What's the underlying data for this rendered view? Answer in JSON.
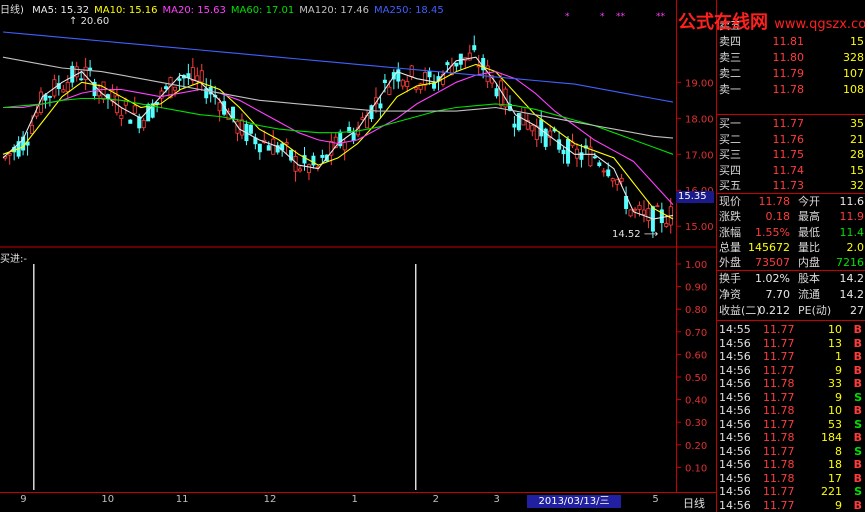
{
  "chart_data": {
    "type": "candlestick",
    "period_label": "日线",
    "moving_averages": [
      {
        "name": "MA5",
        "value": "15.32",
        "color": "#e8e8e8"
      },
      {
        "name": "MA10",
        "value": "15.16",
        "color": "#ffff00"
      },
      {
        "name": "MA20",
        "value": "15.63",
        "color": "#ff40ff"
      },
      {
        "name": "MA60",
        "value": "17.01",
        "color": "#00e000"
      },
      {
        "name": "MA120",
        "value": "17.46",
        "color": "#c0c0c0"
      },
      {
        "name": "MA250",
        "value": "18.45",
        "color": "#4060ff"
      }
    ],
    "title_prefix": "日线)",
    "y_ticks": [
      "19.00",
      "18.00",
      "17.00",
      "16.00",
      "15.00"
    ],
    "ylim": [
      14.45,
      20.9
    ],
    "high_label": "20.60",
    "low_label": "14.52",
    "current_tag": "15.35",
    "x_ticks": [
      "9",
      "10",
      "11",
      "12",
      "1",
      "2",
      "3",
      "5"
    ],
    "highlight_date": "2013/03/13/三",
    "ma_series": {
      "ma5": [
        16.9,
        17.4,
        18.6,
        19.0,
        19.3,
        18.7,
        18.3,
        18.0,
        18.6,
        19.2,
        19.0,
        18.5,
        17.7,
        17.4,
        17.2,
        16.7,
        16.6,
        17.3,
        17.7,
        18.5,
        19.3,
        19.1,
        19.0,
        19.6,
        19.7,
        19.0,
        18.1,
        17.8,
        17.4,
        17.0,
        17.0,
        16.6,
        15.4,
        15.2,
        15.3
      ],
      "ma10": [
        17.0,
        17.2,
        17.9,
        18.6,
        19.0,
        18.9,
        18.6,
        18.3,
        18.4,
        18.8,
        19.0,
        18.8,
        18.3,
        17.7,
        17.4,
        17.0,
        16.7,
        16.9,
        17.3,
        17.9,
        18.6,
        18.9,
        19.0,
        19.3,
        19.5,
        19.3,
        18.7,
        18.1,
        17.7,
        17.3,
        17.1,
        16.9,
        16.2,
        15.5,
        15.2
      ],
      "ma20": [
        18.3,
        18.3,
        18.4,
        18.5,
        18.7,
        18.8,
        18.8,
        18.7,
        18.6,
        18.7,
        18.8,
        18.7,
        18.5,
        18.2,
        17.9,
        17.6,
        17.4,
        17.3,
        17.4,
        17.7,
        18.0,
        18.4,
        18.7,
        19.0,
        19.2,
        19.3,
        19.1,
        18.7,
        18.2,
        17.8,
        17.4,
        17.1,
        16.8,
        16.2,
        15.6
      ],
      "ma60": [
        18.3,
        18.35,
        18.4,
        18.5,
        18.55,
        18.55,
        18.5,
        18.4,
        18.3,
        18.2,
        18.1,
        18.05,
        17.95,
        17.8,
        17.7,
        17.65,
        17.6,
        17.6,
        17.65,
        17.75,
        17.9,
        18.05,
        18.2,
        18.3,
        18.35,
        18.4,
        18.35,
        18.25,
        18.1,
        17.95,
        17.8,
        17.6,
        17.4,
        17.2,
        17.0
      ],
      "ma120": [
        19.7,
        19.6,
        19.5,
        19.4,
        19.35,
        19.3,
        19.2,
        19.1,
        19.0,
        18.9,
        18.8,
        18.7,
        18.6,
        18.5,
        18.45,
        18.4,
        18.35,
        18.3,
        18.25,
        18.2,
        18.2,
        18.2,
        18.2,
        18.2,
        18.25,
        18.3,
        18.2,
        18.1,
        18.0,
        17.9,
        17.8,
        17.7,
        17.6,
        17.5,
        17.45
      ],
      "ma250": [
        20.4,
        20.35,
        20.3,
        20.25,
        20.2,
        20.15,
        20.1,
        20.05,
        20.0,
        19.95,
        19.9,
        19.85,
        19.8,
        19.75,
        19.7,
        19.65,
        19.6,
        19.55,
        19.5,
        19.45,
        19.4,
        19.35,
        19.3,
        19.25,
        19.2,
        19.15,
        19.1,
        19.05,
        19.0,
        18.95,
        18.85,
        18.75,
        18.65,
        18.55,
        18.45
      ]
    },
    "indicator_label": "买进:-",
    "indicator_ticks": [
      "1.00",
      "0.90",
      "0.80",
      "0.70",
      "0.60",
      "0.50",
      "0.40",
      "0.30",
      "0.20",
      "0.10"
    ],
    "signals": [
      {
        "pos": 0.05,
        "value": 1.0
      },
      {
        "pos": 0.615,
        "value": 1.0
      }
    ],
    "markers": [
      "*",
      "*",
      "**",
      "**"
    ]
  },
  "quotes": {
    "asks": [
      {
        "label": "卖五",
        "price": "",
        "vol": ""
      },
      {
        "label": "卖四",
        "price": "11.81",
        "vol": "15"
      },
      {
        "label": "卖三",
        "price": "11.80",
        "vol": "328"
      },
      {
        "label": "卖二",
        "price": "11.79",
        "vol": "107"
      },
      {
        "label": "卖一",
        "price": "11.78",
        "vol": "108"
      }
    ],
    "bids": [
      {
        "label": "买一",
        "price": "11.77",
        "vol": "35"
      },
      {
        "label": "买二",
        "price": "11.76",
        "vol": "21"
      },
      {
        "label": "买三",
        "price": "11.75",
        "vol": "28"
      },
      {
        "label": "买四",
        "price": "11.74",
        "vol": "15"
      },
      {
        "label": "买五",
        "price": "11.73",
        "vol": "32"
      }
    ],
    "stats": [
      {
        "l1": "现价",
        "v1": "11.78",
        "c1": "red",
        "l2": "今开",
        "v2": "11.6",
        "c2": "white"
      },
      {
        "l1": "涨跌",
        "v1": "0.18",
        "c1": "red",
        "l2": "最高",
        "v2": "11.9",
        "c2": "red"
      },
      {
        "l1": "涨幅",
        "v1": "1.55%",
        "c1": "red",
        "l2": "最低",
        "v2": "11.4",
        "c2": "green"
      },
      {
        "l1": "总量",
        "v1": "145672",
        "c1": "yellow",
        "l2": "量比",
        "v2": "2.0",
        "c2": "yellow"
      },
      {
        "l1": "外盘",
        "v1": "73507",
        "c1": "red",
        "l2": "内盘",
        "v2": "7216",
        "c2": "green"
      }
    ],
    "fundamentals": [
      {
        "l1": "换手",
        "v1": "1.02%",
        "l2": "股本",
        "v2": "14.2"
      },
      {
        "l1": "净资",
        "v1": "7.70",
        "l2": "流通",
        "v2": "14.2"
      },
      {
        "l1": "收益(二)",
        "v1": "0.212",
        "l2": "PE(动)",
        "v2": "27"
      }
    ],
    "ticks": [
      {
        "time": "14:55",
        "price": "11.77",
        "vol": "10",
        "dir": "B"
      },
      {
        "time": "14:56",
        "price": "11.77",
        "vol": "13",
        "dir": "B"
      },
      {
        "time": "14:56",
        "price": "11.77",
        "vol": "1",
        "dir": "B"
      },
      {
        "time": "14:56",
        "price": "11.77",
        "vol": "9",
        "dir": "B"
      },
      {
        "time": "14:56",
        "price": "11.78",
        "vol": "33",
        "dir": "B"
      },
      {
        "time": "14:56",
        "price": "11.77",
        "vol": "9",
        "dir": "S"
      },
      {
        "time": "14:56",
        "price": "11.78",
        "vol": "10",
        "dir": "B"
      },
      {
        "time": "14:56",
        "price": "11.77",
        "vol": "53",
        "dir": "S"
      },
      {
        "time": "14:56",
        "price": "11.78",
        "vol": "184",
        "dir": "B"
      },
      {
        "time": "14:56",
        "price": "11.77",
        "vol": "8",
        "dir": "S"
      },
      {
        "time": "14:56",
        "price": "11.78",
        "vol": "18",
        "dir": "B"
      },
      {
        "time": "14:56",
        "price": "11.78",
        "vol": "17",
        "dir": "B"
      },
      {
        "time": "14:56",
        "price": "11.77",
        "vol": "221",
        "dir": "S"
      },
      {
        "time": "14:56",
        "price": "11.77",
        "vol": "9",
        "dir": "B"
      }
    ]
  },
  "watermark": {
    "text": "公式在线网",
    "url": "www.qgszx.com.cn"
  }
}
